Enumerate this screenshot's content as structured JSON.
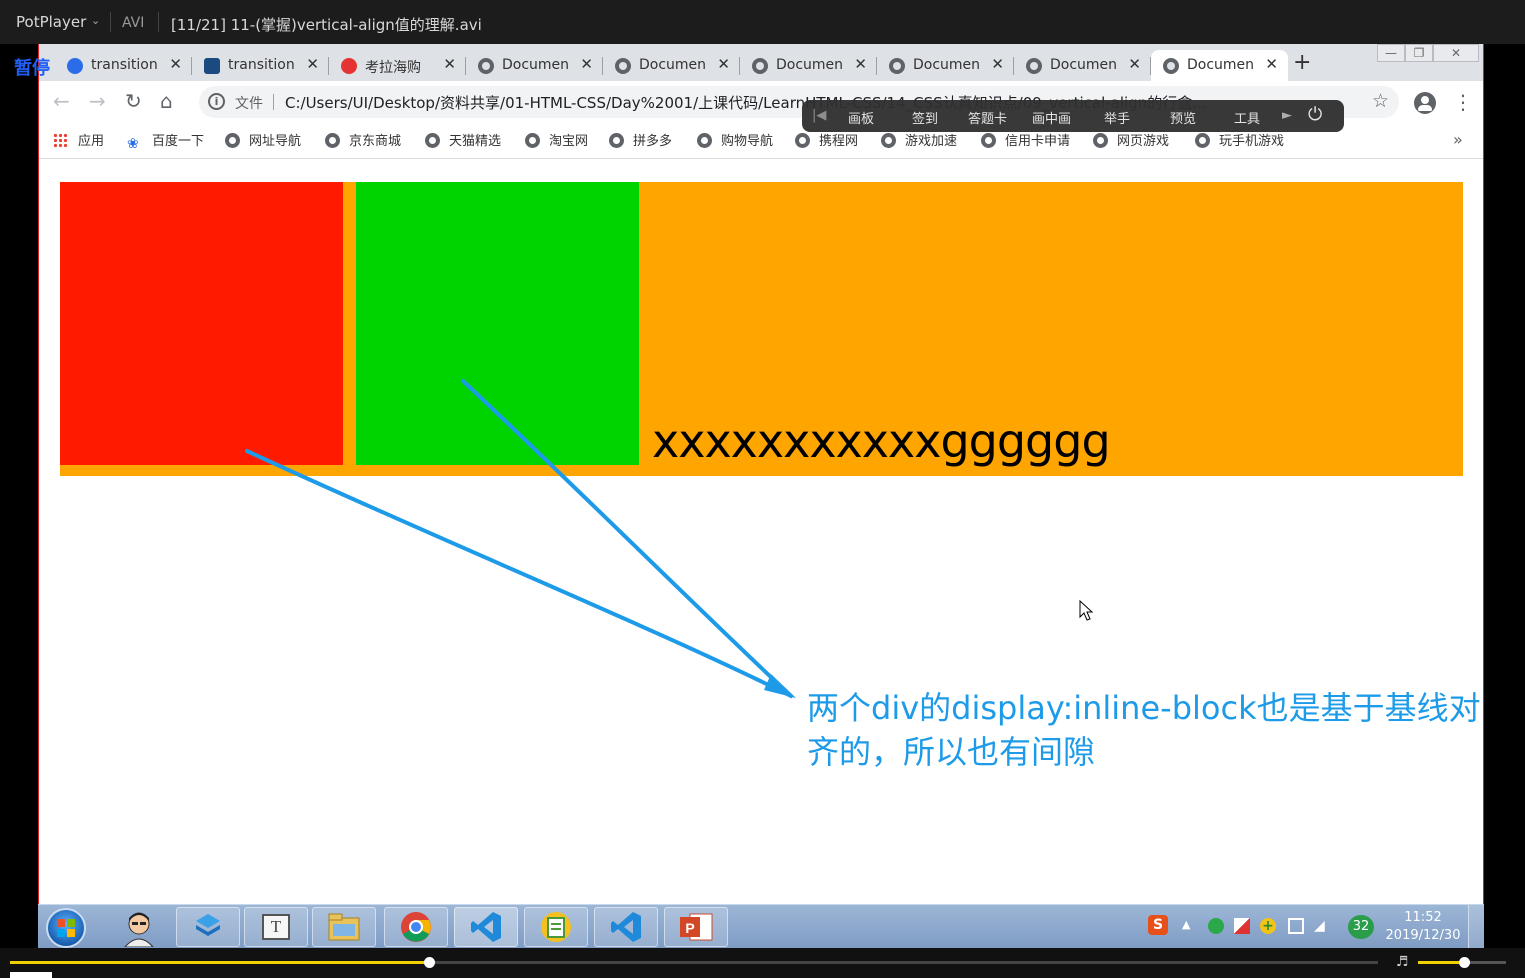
{
  "player": {
    "app_name": "PotPlayer",
    "format": "AVI",
    "file_title": "[11/21] 11-(掌握)vertical-align值的理解.avi",
    "pause_label": "暂停",
    "seek_progress": 0.306,
    "volume_level": 0.52
  },
  "browser": {
    "tabs": [
      {
        "label": "transition",
        "icon": "baidu-paw-icon"
      },
      {
        "label": "transition",
        "icon": "site-icon"
      },
      {
        "label": "考拉海购",
        "icon": "kaola-icon"
      },
      {
        "label": "Documen",
        "icon": "globe-icon"
      },
      {
        "label": "Documen",
        "icon": "globe-icon"
      },
      {
        "label": "Documen",
        "icon": "globe-icon"
      },
      {
        "label": "Documen",
        "icon": "globe-icon"
      },
      {
        "label": "Documen",
        "icon": "globe-icon"
      },
      {
        "label": "Documen",
        "icon": "globe-icon",
        "active": true
      }
    ],
    "omnibox": {
      "scheme_label": "文件",
      "url": "C:/Users/UI/Desktop/资料共享/01-HTML-CSS/Day%2001/上课代码/LearnHTML-CSS/14_CSS认真知识点/09_vertical-align的行盒..."
    },
    "bookmarks": [
      {
        "label": "应用",
        "icon": "apps-icon"
      },
      {
        "label": "百度一下",
        "icon": "baidu-paw-icon"
      },
      {
        "label": "网址导航",
        "icon": "globe-icon"
      },
      {
        "label": "京东商城",
        "icon": "globe-icon"
      },
      {
        "label": "天猫精选",
        "icon": "globe-icon"
      },
      {
        "label": "淘宝网",
        "icon": "globe-icon"
      },
      {
        "label": "拼多多",
        "icon": "globe-icon"
      },
      {
        "label": "购物导航",
        "icon": "globe-icon"
      },
      {
        "label": "携程网",
        "icon": "globe-icon"
      },
      {
        "label": "游戏加速",
        "icon": "globe-icon"
      },
      {
        "label": "信用卡申请",
        "icon": "globe-icon"
      },
      {
        "label": "网页游戏",
        "icon": "globe-icon"
      },
      {
        "label": "玩手机游戏",
        "icon": "globe-icon"
      }
    ],
    "bookmarks_more": "»"
  },
  "overlay_toolbar": {
    "items": [
      "画板",
      "签到",
      "答题卡",
      "画中画",
      "举手",
      "预览",
      "工具"
    ]
  },
  "page": {
    "inline_text": "xxxxxxxxxxxgggggg",
    "annotation": "两个div的display:inline-block也是基于基线对齐的，所以也有间隙",
    "colors": {
      "container": "#ffa500",
      "red_box": "#ff1a00",
      "green_box": "#00d400",
      "annotation": "#1e9be8"
    }
  },
  "taskbar": {
    "tray_badge": "32",
    "clock_time": "11:52",
    "clock_date": "2019/12/30"
  }
}
